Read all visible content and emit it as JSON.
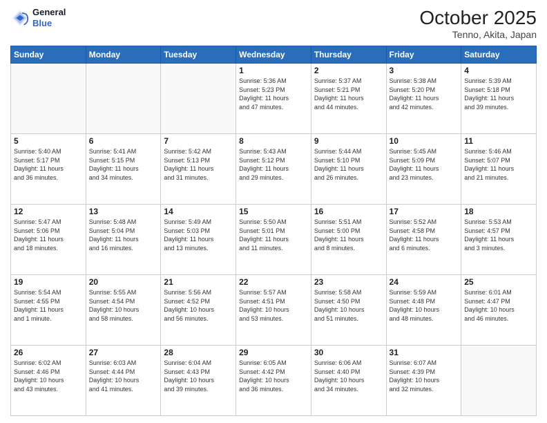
{
  "header": {
    "logo_line1": "General",
    "logo_line2": "Blue",
    "title": "October 2025",
    "subtitle": "Tenno, Akita, Japan"
  },
  "days_of_week": [
    "Sunday",
    "Monday",
    "Tuesday",
    "Wednesday",
    "Thursday",
    "Friday",
    "Saturday"
  ],
  "weeks": [
    [
      {
        "day": "",
        "info": ""
      },
      {
        "day": "",
        "info": ""
      },
      {
        "day": "",
        "info": ""
      },
      {
        "day": "1",
        "info": "Sunrise: 5:36 AM\nSunset: 5:23 PM\nDaylight: 11 hours\nand 47 minutes."
      },
      {
        "day": "2",
        "info": "Sunrise: 5:37 AM\nSunset: 5:21 PM\nDaylight: 11 hours\nand 44 minutes."
      },
      {
        "day": "3",
        "info": "Sunrise: 5:38 AM\nSunset: 5:20 PM\nDaylight: 11 hours\nand 42 minutes."
      },
      {
        "day": "4",
        "info": "Sunrise: 5:39 AM\nSunset: 5:18 PM\nDaylight: 11 hours\nand 39 minutes."
      }
    ],
    [
      {
        "day": "5",
        "info": "Sunrise: 5:40 AM\nSunset: 5:17 PM\nDaylight: 11 hours\nand 36 minutes."
      },
      {
        "day": "6",
        "info": "Sunrise: 5:41 AM\nSunset: 5:15 PM\nDaylight: 11 hours\nand 34 minutes."
      },
      {
        "day": "7",
        "info": "Sunrise: 5:42 AM\nSunset: 5:13 PM\nDaylight: 11 hours\nand 31 minutes."
      },
      {
        "day": "8",
        "info": "Sunrise: 5:43 AM\nSunset: 5:12 PM\nDaylight: 11 hours\nand 29 minutes."
      },
      {
        "day": "9",
        "info": "Sunrise: 5:44 AM\nSunset: 5:10 PM\nDaylight: 11 hours\nand 26 minutes."
      },
      {
        "day": "10",
        "info": "Sunrise: 5:45 AM\nSunset: 5:09 PM\nDaylight: 11 hours\nand 23 minutes."
      },
      {
        "day": "11",
        "info": "Sunrise: 5:46 AM\nSunset: 5:07 PM\nDaylight: 11 hours\nand 21 minutes."
      }
    ],
    [
      {
        "day": "12",
        "info": "Sunrise: 5:47 AM\nSunset: 5:06 PM\nDaylight: 11 hours\nand 18 minutes."
      },
      {
        "day": "13",
        "info": "Sunrise: 5:48 AM\nSunset: 5:04 PM\nDaylight: 11 hours\nand 16 minutes."
      },
      {
        "day": "14",
        "info": "Sunrise: 5:49 AM\nSunset: 5:03 PM\nDaylight: 11 hours\nand 13 minutes."
      },
      {
        "day": "15",
        "info": "Sunrise: 5:50 AM\nSunset: 5:01 PM\nDaylight: 11 hours\nand 11 minutes."
      },
      {
        "day": "16",
        "info": "Sunrise: 5:51 AM\nSunset: 5:00 PM\nDaylight: 11 hours\nand 8 minutes."
      },
      {
        "day": "17",
        "info": "Sunrise: 5:52 AM\nSunset: 4:58 PM\nDaylight: 11 hours\nand 6 minutes."
      },
      {
        "day": "18",
        "info": "Sunrise: 5:53 AM\nSunset: 4:57 PM\nDaylight: 11 hours\nand 3 minutes."
      }
    ],
    [
      {
        "day": "19",
        "info": "Sunrise: 5:54 AM\nSunset: 4:55 PM\nDaylight: 11 hours\nand 1 minute."
      },
      {
        "day": "20",
        "info": "Sunrise: 5:55 AM\nSunset: 4:54 PM\nDaylight: 10 hours\nand 58 minutes."
      },
      {
        "day": "21",
        "info": "Sunrise: 5:56 AM\nSunset: 4:52 PM\nDaylight: 10 hours\nand 56 minutes."
      },
      {
        "day": "22",
        "info": "Sunrise: 5:57 AM\nSunset: 4:51 PM\nDaylight: 10 hours\nand 53 minutes."
      },
      {
        "day": "23",
        "info": "Sunrise: 5:58 AM\nSunset: 4:50 PM\nDaylight: 10 hours\nand 51 minutes."
      },
      {
        "day": "24",
        "info": "Sunrise: 5:59 AM\nSunset: 4:48 PM\nDaylight: 10 hours\nand 48 minutes."
      },
      {
        "day": "25",
        "info": "Sunrise: 6:01 AM\nSunset: 4:47 PM\nDaylight: 10 hours\nand 46 minutes."
      }
    ],
    [
      {
        "day": "26",
        "info": "Sunrise: 6:02 AM\nSunset: 4:46 PM\nDaylight: 10 hours\nand 43 minutes."
      },
      {
        "day": "27",
        "info": "Sunrise: 6:03 AM\nSunset: 4:44 PM\nDaylight: 10 hours\nand 41 minutes."
      },
      {
        "day": "28",
        "info": "Sunrise: 6:04 AM\nSunset: 4:43 PM\nDaylight: 10 hours\nand 39 minutes."
      },
      {
        "day": "29",
        "info": "Sunrise: 6:05 AM\nSunset: 4:42 PM\nDaylight: 10 hours\nand 36 minutes."
      },
      {
        "day": "30",
        "info": "Sunrise: 6:06 AM\nSunset: 4:40 PM\nDaylight: 10 hours\nand 34 minutes."
      },
      {
        "day": "31",
        "info": "Sunrise: 6:07 AM\nSunset: 4:39 PM\nDaylight: 10 hours\nand 32 minutes."
      },
      {
        "day": "",
        "info": ""
      }
    ]
  ]
}
